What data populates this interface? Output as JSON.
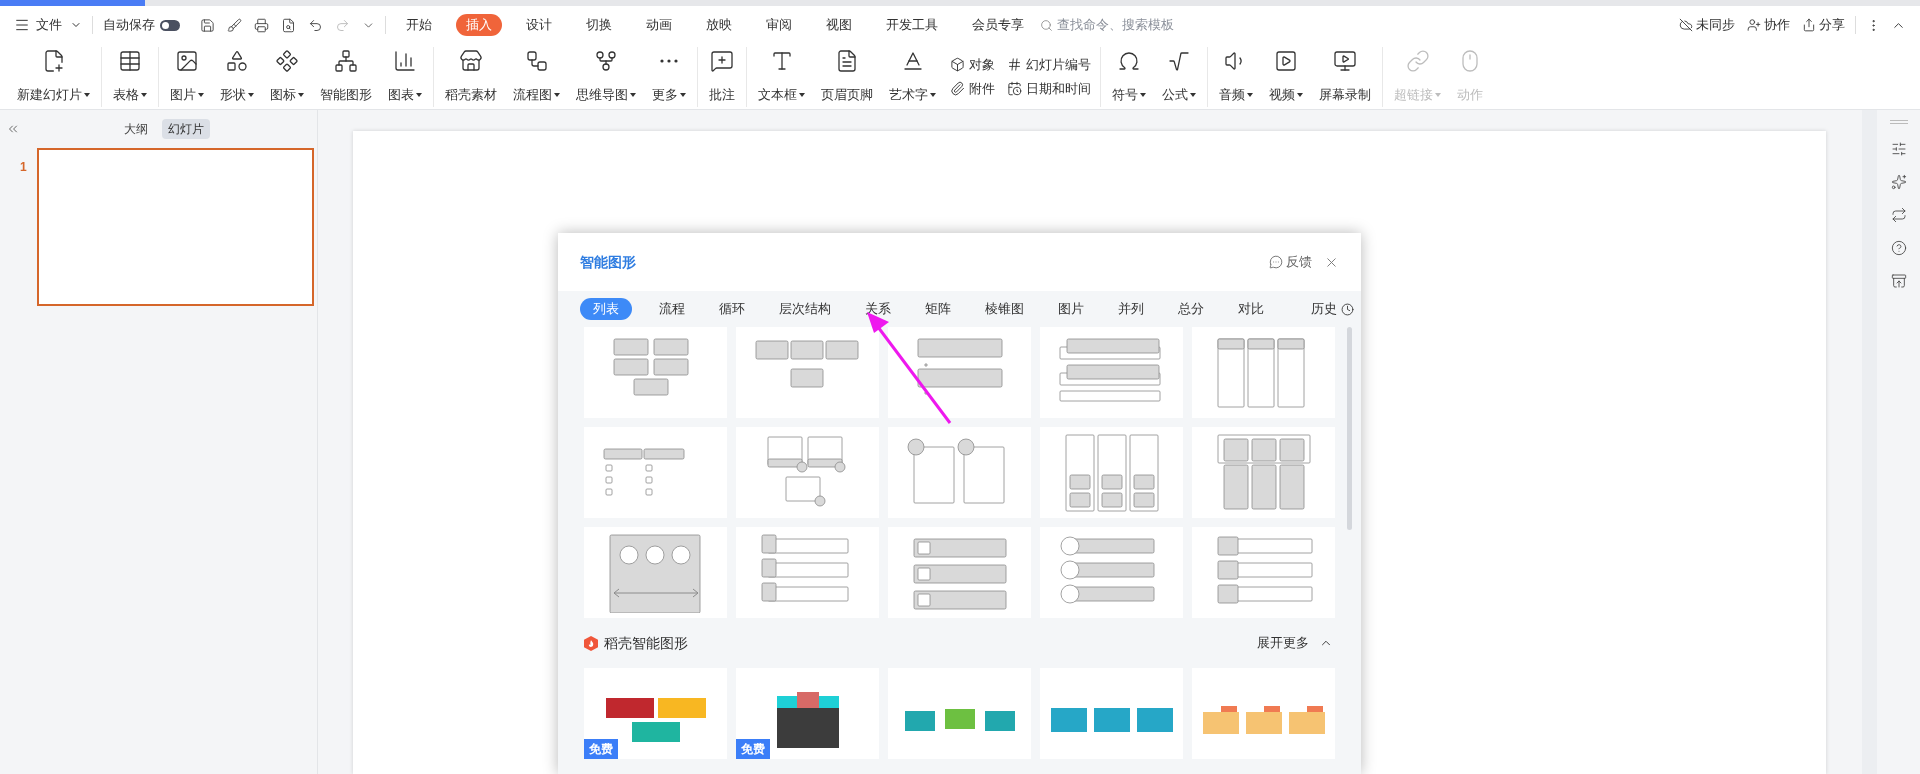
{
  "toolbar": {
    "file_menu": "文件",
    "autosave": {
      "label": "自动保存",
      "on": false
    },
    "tabs": [
      {
        "label": "开始",
        "selected": false
      },
      {
        "label": "插入",
        "selected": true
      },
      {
        "label": "设计",
        "selected": false
      },
      {
        "label": "切换",
        "selected": false
      },
      {
        "label": "动画",
        "selected": false
      },
      {
        "label": "放映",
        "selected": false
      },
      {
        "label": "审阅",
        "selected": false
      },
      {
        "label": "视图",
        "selected": false
      },
      {
        "label": "开发工具",
        "selected": false
      },
      {
        "label": "会员专享",
        "selected": false
      }
    ],
    "search": {
      "placeholder": "查找命令、搜索模板"
    },
    "actions": [
      "未同步",
      "协作",
      "分享"
    ]
  },
  "ribbon": {
    "groups": [
      {
        "items": [
          {
            "label": "新建幻灯片",
            "kind": "large",
            "dropdown": true,
            "disabled": false
          }
        ]
      },
      {
        "items": [
          {
            "label": "表格",
            "kind": "large",
            "dropdown": true,
            "disabled": false
          }
        ]
      },
      {
        "items": [
          {
            "label": "图片",
            "kind": "large",
            "dropdown": true,
            "disabled": false
          },
          {
            "label": "形状",
            "kind": "large",
            "dropdown": true,
            "disabled": false
          },
          {
            "label": "图标",
            "kind": "large",
            "dropdown": true,
            "disabled": false
          },
          {
            "label": "智能图形",
            "kind": "large",
            "dropdown": false,
            "disabled": false
          },
          {
            "label": "图表",
            "kind": "large",
            "dropdown": true,
            "disabled": false
          }
        ]
      },
      {
        "items": [
          {
            "label": "稻壳素材",
            "kind": "large",
            "dropdown": false,
            "disabled": false
          },
          {
            "label": "流程图",
            "kind": "large",
            "dropdown": true,
            "disabled": false
          },
          {
            "label": "思维导图",
            "kind": "large",
            "dropdown": true,
            "disabled": false
          },
          {
            "label": "更多",
            "kind": "large",
            "dropdown": true,
            "disabled": false
          }
        ]
      },
      {
        "items": [
          {
            "label": "批注",
            "kind": "large",
            "dropdown": false,
            "disabled": false
          }
        ]
      },
      {
        "items": [
          {
            "label": "文本框",
            "kind": "large",
            "dropdown": true,
            "disabled": false
          },
          {
            "label": "页眉页脚",
            "kind": "large",
            "dropdown": false,
            "disabled": false
          },
          {
            "label": "艺术字",
            "kind": "large",
            "dropdown": true,
            "disabled": false
          },
          {
            "label": "对象",
            "kind": "small",
            "disabled": false
          },
          {
            "label": "附件",
            "kind": "small",
            "disabled": false
          },
          {
            "label": "幻灯片编号",
            "kind": "small",
            "disabled": false
          },
          {
            "label": "日期和时间",
            "kind": "small",
            "disabled": false
          }
        ]
      },
      {
        "items": [
          {
            "label": "符号",
            "kind": "large",
            "dropdown": true,
            "disabled": false
          },
          {
            "label": "公式",
            "kind": "large",
            "dropdown": true,
            "disabled": false
          }
        ]
      },
      {
        "items": [
          {
            "label": "音频",
            "kind": "large",
            "dropdown": true,
            "disabled": false
          },
          {
            "label": "视频",
            "kind": "large",
            "dropdown": true,
            "disabled": false
          },
          {
            "label": "屏幕录制",
            "kind": "large",
            "dropdown": false,
            "disabled": false
          }
        ]
      },
      {
        "items": [
          {
            "label": "超链接",
            "kind": "large",
            "dropdown": true,
            "disabled": true
          },
          {
            "label": "动作",
            "kind": "large",
            "dropdown": false,
            "disabled": true
          }
        ]
      }
    ]
  },
  "slides_panel": {
    "tabs": [
      {
        "label": "大纲",
        "selected": false
      },
      {
        "label": "幻灯片",
        "selected": true
      }
    ],
    "slides": [
      {
        "number": "1",
        "selected": true
      }
    ]
  },
  "dialog": {
    "title": "智能图形",
    "feedback": "反馈",
    "categories": [
      {
        "label": "列表",
        "selected": true
      },
      {
        "label": "流程",
        "selected": false
      },
      {
        "label": "循环",
        "selected": false
      },
      {
        "label": "层次结构",
        "selected": false
      },
      {
        "label": "关系",
        "selected": false
      },
      {
        "label": "矩阵",
        "selected": false
      },
      {
        "label": "棱锥图",
        "selected": false
      },
      {
        "label": "图片",
        "selected": false
      },
      {
        "label": "并列",
        "selected": false
      },
      {
        "label": "总分",
        "selected": false
      },
      {
        "label": "对比",
        "selected": false
      }
    ],
    "history": "历史",
    "templates": [
      {
        "kind": "diagram"
      },
      {
        "kind": "diagram"
      },
      {
        "kind": "diagram"
      },
      {
        "kind": "diagram"
      },
      {
        "kind": "diagram"
      },
      {
        "kind": "diagram"
      },
      {
        "kind": "diagram"
      },
      {
        "kind": "diagram"
      },
      {
        "kind": "diagram"
      },
      {
        "kind": "diagram"
      },
      {
        "kind": "diagram"
      },
      {
        "kind": "diagram"
      },
      {
        "kind": "diagram"
      },
      {
        "kind": "diagram"
      },
      {
        "kind": "diagram"
      }
    ],
    "section": {
      "title": "稻壳智能图形",
      "expand": "展开更多",
      "templates": [
        {
          "kind": "preview",
          "badge": "免费"
        },
        {
          "kind": "preview",
          "badge": "免费"
        },
        {
          "kind": "preview"
        },
        {
          "kind": "preview"
        },
        {
          "kind": "preview"
        }
      ]
    }
  }
}
